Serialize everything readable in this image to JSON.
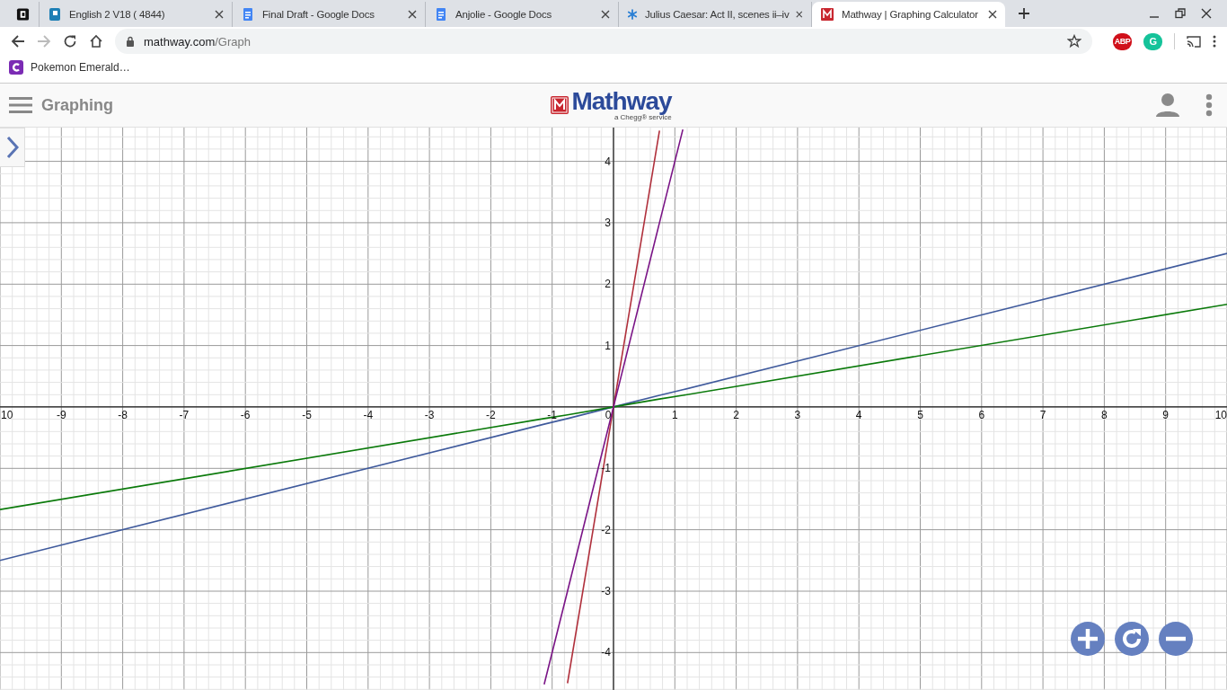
{
  "browser": {
    "tabs": [
      {
        "selected": false,
        "pinned": true
      },
      {
        "title": "English 2 V18 ( 4844)",
        "selected": false,
        "pinned": false
      },
      {
        "title": "Final Draft - Google Docs",
        "selected": false,
        "pinned": false
      },
      {
        "title": "Anjolie - Google Docs",
        "selected": false,
        "pinned": false
      },
      {
        "title": "Julius Caesar: Act II, scenes ii–iv",
        "selected": false,
        "pinned": false
      },
      {
        "title": "Mathway | Graphing Calculator",
        "selected": true,
        "pinned": false
      }
    ],
    "url_host": "mathway.com",
    "url_path": "/Graph",
    "extensions": [
      {
        "label": "ABP",
        "kind": "adblock"
      },
      {
        "label": "G",
        "kind": "grammar"
      }
    ],
    "bookmarks": [
      {
        "label": "Pokemon Emerald…"
      }
    ]
  },
  "header": {
    "title": "Graphing",
    "logo": "Mathway",
    "logo_sub": "a Chegg® service"
  },
  "graph": {
    "chart_data": {
      "type": "line",
      "grid": true,
      "x": [
        -10,
        -1.13,
        -0.75,
        0,
        0.75,
        1.13,
        10
      ],
      "series": [
        {
          "color": "#3f5a9c",
          "values": [
            -2.5,
            -0.28,
            -0.19,
            0,
            0.19,
            0.28,
            2.5
          ]
        },
        {
          "color": "#0b7a0b",
          "values": [
            -1.67,
            -0.19,
            -0.13,
            0,
            0.13,
            0.19,
            1.67
          ]
        },
        {
          "color": "#b0303c",
          "values": [
            null,
            null,
            -4.5,
            0,
            4.5,
            null,
            null
          ]
        },
        {
          "color": "#7a1486",
          "values": [
            null,
            -4.52,
            -3,
            0,
            3,
            4.52,
            null
          ]
        }
      ],
      "xlim": [
        -10,
        10
      ],
      "ylim": [
        -4.61,
        4.55
      ],
      "xticks": [
        {
          "value": -10,
          "label": "10"
        },
        -9,
        -8,
        -7,
        -6,
        -5,
        -4,
        -3,
        -2,
        -1,
        0,
        1,
        2,
        3,
        4,
        5,
        6,
        7,
        8,
        9,
        10
      ],
      "yticks": [
        -4,
        -3,
        -2,
        -1,
        1,
        2,
        3,
        4
      ]
    }
  }
}
